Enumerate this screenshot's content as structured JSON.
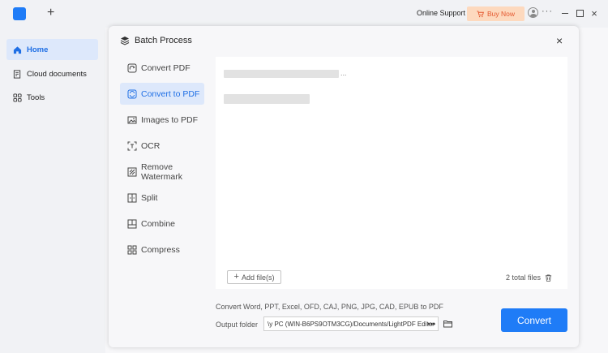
{
  "topbar": {
    "new_tab": "+",
    "support": "Online Support",
    "buy": "Buy Now",
    "more": "···",
    "close": "×"
  },
  "sidebar": {
    "items": [
      {
        "label": "Home"
      },
      {
        "label": "Cloud documents"
      },
      {
        "label": "Tools"
      }
    ]
  },
  "modal": {
    "title": "Batch Process",
    "close": "×",
    "menu": [
      {
        "label": "Convert PDF"
      },
      {
        "label": "Convert to PDF"
      },
      {
        "label": "Images to PDF"
      },
      {
        "label": "OCR"
      },
      {
        "label": "Remove Watermark"
      },
      {
        "label": "Split"
      },
      {
        "label": "Combine"
      },
      {
        "label": "Compress"
      }
    ],
    "file_preview": "...",
    "add_files": "Add file(s)",
    "total_files": "2 total files",
    "description": "Convert Word, PPT, Excel, OFD, CAJ, PNG, JPG, CAD, EPUB to PDF",
    "output_label": "Output folder",
    "output_path": "\\y PC (WIN-B6PS9OTM3CG)/Documents/LightPDF Editor",
    "output_more": "•••",
    "convert": "Convert"
  },
  "colors": {
    "accent": "#1f7cf7",
    "active_bg": "#dde8fb",
    "buy_bg": "#fdd9be",
    "buy_text": "#e4572e"
  }
}
